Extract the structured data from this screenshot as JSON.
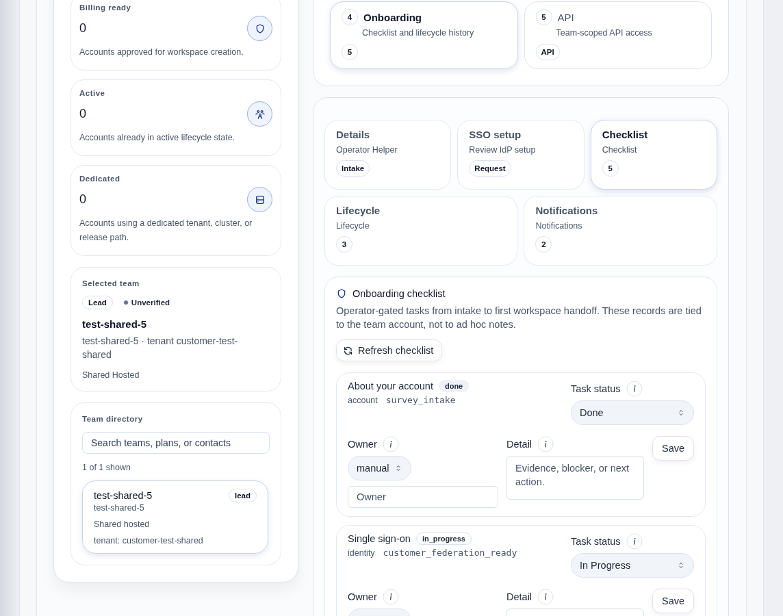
{
  "stats": [
    {
      "label": "Billing ready",
      "value": "0",
      "description": "Accounts approved for workspace creation."
    },
    {
      "label": "Active",
      "value": "0",
      "description": "Accounts already in active lifecycle state."
    },
    {
      "label": "Dedicated",
      "value": "0",
      "description": "Accounts using a dedicated tenant, cluster, or release path."
    }
  ],
  "selected_team": {
    "heading": "Selected team",
    "role": "Lead",
    "verification": {
      "label": "Unverified",
      "verified": false
    },
    "name": "test-shared-5",
    "subtitle": "test-shared-5 · tenant customer-test-shared",
    "hosting": "Shared Hosted"
  },
  "directory": {
    "heading": "Team directory",
    "search": {
      "placeholder": "Search teams, plans, or contacts"
    },
    "count": "1 of 1 shown",
    "teams": [
      {
        "name": "test-shared-5",
        "role": "lead",
        "slug": "test-shared-5",
        "hosting": "Shared hosted",
        "tenant": "tenant: customer-test-shared",
        "selected": true
      }
    ]
  },
  "sections": [
    {
      "number": "4",
      "title": "Onboarding",
      "description": "Checklist and lifecycle history",
      "badge": "5",
      "selected": true
    },
    {
      "number": "5",
      "title": "API",
      "description": "Team-scoped API access",
      "badge": "API",
      "selected": false
    }
  ],
  "subtabs": [
    {
      "title": "Details",
      "subtitle": "Operator Helper",
      "badge": "Intake",
      "selected": false
    },
    {
      "title": "SSO setup",
      "subtitle": "Review IdP setup",
      "badge": "Request",
      "selected": false
    },
    {
      "title": "Checklist",
      "subtitle": "Checklist",
      "badge": "5",
      "selected": true
    },
    {
      "title": "Lifecycle",
      "subtitle": "Lifecycle",
      "badge": "3",
      "selected": false
    },
    {
      "title": "Notifications",
      "subtitle": "Notifications",
      "badge": "2",
      "selected": false
    }
  ],
  "checklist": {
    "title": "Onboarding checklist",
    "description": "Operator-gated tasks from intake to first workspace handoff. These records are tied to the team account, not to ad hoc notes.",
    "refresh_button": "Refresh checklist",
    "tasks": [
      {
        "title": "About your account",
        "status_badge": "done",
        "done": true,
        "category": "account",
        "key": "survey_intake",
        "status_label": "Task status",
        "status_value": "Done",
        "owner_label": "Owner",
        "owner_mode": "manual",
        "owner_placeholder": "Owner",
        "detail_label": "Detail",
        "detail_placeholder": "Evidence, blocker, or next action.",
        "save": "Save"
      },
      {
        "title": "Single sign-on",
        "status_badge": "in_progress",
        "done": false,
        "category": "identity",
        "key": "customer_federation_ready",
        "status_label": "Task status",
        "status_value": "In Progress",
        "owner_label": "Owner",
        "detail_label": "Detail",
        "save": "Save"
      }
    ]
  }
}
